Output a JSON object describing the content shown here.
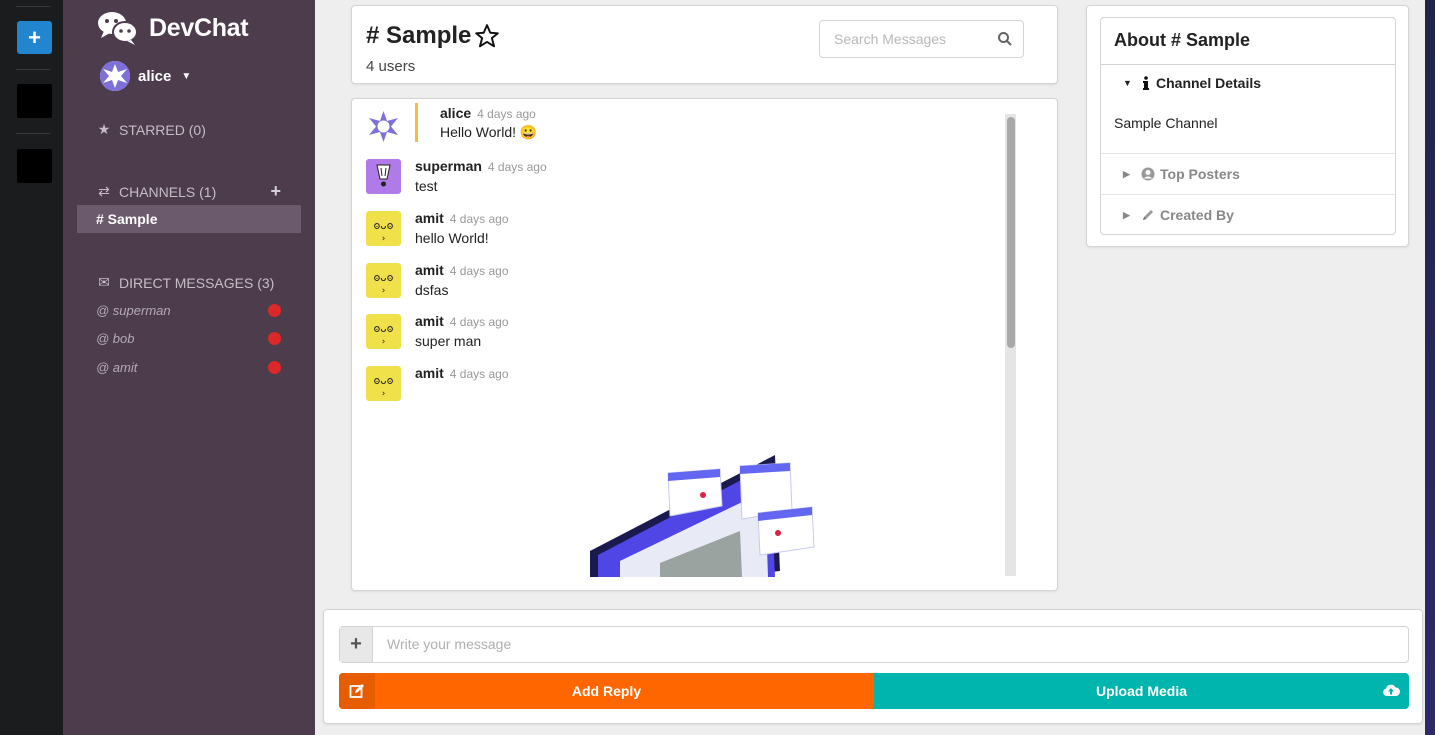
{
  "app": {
    "name": "DevChat"
  },
  "user": {
    "name": "alice"
  },
  "sidebar": {
    "starred": "STARRED (0)",
    "channels": "CHANNELS (1)",
    "active_channel": "# Sample",
    "direct_messages": "DIRECT MESSAGES (3)",
    "dms": [
      {
        "label": "@ superman",
        "status_color": "#db2828"
      },
      {
        "label": "@ bob",
        "status_color": "#db2828"
      },
      {
        "label": "@ amit",
        "status_color": "#db2828"
      }
    ]
  },
  "channel": {
    "title": "# Sample",
    "users": "4 users",
    "search_placeholder": "Search Messages"
  },
  "messages": [
    {
      "author": "alice",
      "time": "4 days ago",
      "text": "Hello World! 😀"
    },
    {
      "author": "superman",
      "time": "4 days ago",
      "text": "test"
    },
    {
      "author": "amit",
      "time": "4 days ago",
      "text": "hello World!"
    },
    {
      "author": "amit",
      "time": "4 days ago",
      "text": "dsfas"
    },
    {
      "author": "amit",
      "time": "4 days ago",
      "text": "super man"
    },
    {
      "author": "amit",
      "time": "4 days ago",
      "text": ""
    }
  ],
  "about": {
    "title": "About # Sample",
    "details_label": "Channel Details",
    "details_text": "Sample Channel",
    "top_posters_label": "Top Posters",
    "created_by_label": "Created By"
  },
  "compose": {
    "placeholder": "Write your message",
    "add_reply": "Add Reply",
    "upload_media": "Upload Media"
  },
  "colors": {
    "sidebar": "#4c3c4c",
    "reply": "#ff6600",
    "upload": "#00b5ad",
    "rail_button": "#2185d0"
  }
}
